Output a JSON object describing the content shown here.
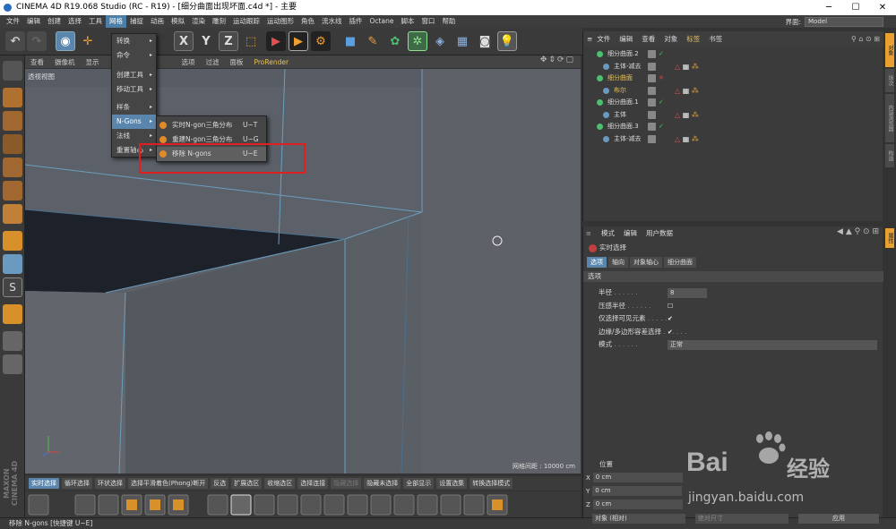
{
  "window": {
    "title": "CINEMA 4D R19.068 Studio (RC - R19) - [细分曲面出现坏面.c4d *] - 主要"
  },
  "menubar": {
    "items": [
      "文件",
      "编辑",
      "创建",
      "选择",
      "工具",
      "网格",
      "捕捉",
      "动画",
      "模拟",
      "渲染",
      "雕刻",
      "运动跟踪",
      "运动图形",
      "角色",
      "流水线",
      "插件",
      "Octane",
      "脚本",
      "窗口",
      "帮助"
    ],
    "active_index": 5,
    "interface_label": "界面:",
    "interface_value": "Model"
  },
  "dropdown": {
    "items": [
      {
        "label": "转换",
        "arrow": "▸"
      },
      {
        "label": "命令",
        "arrow": "▸"
      },
      {
        "label": "创建工具",
        "arrow": "▸"
      },
      {
        "label": "移动工具",
        "arrow": "▸"
      },
      {
        "label": "样条",
        "arrow": "▸"
      },
      {
        "label": "N-Gons",
        "arrow": "▸"
      },
      {
        "label": "法线",
        "arrow": "▸"
      },
      {
        "label": "重置轴心",
        "arrow": "▸"
      }
    ],
    "highlight_index": 5
  },
  "submenu": {
    "items": [
      {
        "label": "实时N-gon三角分布",
        "shortcut": "U~T"
      },
      {
        "label": "重建N-gon三角分布",
        "shortcut": "U~G"
      },
      {
        "label": "移除 N-gons",
        "shortcut": "U~E"
      }
    ],
    "highlight_index": 2
  },
  "viewport": {
    "menu": [
      "查看",
      "摄像机",
      "显示",
      "选项",
      "过滤",
      "面板",
      "ProRender"
    ],
    "label": "透视视图",
    "grid_info": "网格间距 : 10000 cm"
  },
  "bottom_bar": {
    "buttons": [
      "实时选择",
      "循环选择",
      "环状选择",
      "选择平滑着色(Phong)断开",
      "反选",
      "扩展选区",
      "收缩选区",
      "选择连接",
      "隐藏选择",
      "隐藏未选择",
      "全部显示",
      "设置选集",
      "转换选择模式"
    ],
    "active_index": 0,
    "disabled_index": 8
  },
  "status": {
    "text": "移除 N-gons [快捷键 U~E]"
  },
  "object_manager": {
    "menu": [
      "文件",
      "编辑",
      "查看",
      "对象",
      "标签",
      "书签"
    ],
    "active_index": 4,
    "objects": [
      {
        "name": "细分曲面.2",
        "indent": 0,
        "highlight": false,
        "status": "✓"
      },
      {
        "name": "主体-减去",
        "indent": 1,
        "highlight": false,
        "status": ""
      },
      {
        "name": "细分曲面",
        "indent": 0,
        "highlight": true,
        "status": "✕"
      },
      {
        "name": "布尔",
        "indent": 1,
        "highlight": true,
        "status": ""
      },
      {
        "name": "细分曲面.1",
        "indent": 0,
        "highlight": false,
        "status": "✓"
      },
      {
        "name": "主体",
        "indent": 1,
        "highlight": false,
        "status": ""
      },
      {
        "name": "细分曲面.3",
        "indent": 0,
        "highlight": false,
        "status": "✓"
      },
      {
        "name": "主体-减去",
        "indent": 1,
        "highlight": false,
        "status": ""
      }
    ],
    "side_tabs": [
      "对象",
      "场次",
      "内容浏览器",
      "构造"
    ]
  },
  "attributes": {
    "menu": [
      "模式",
      "编辑",
      "用户数据"
    ],
    "title": "实时选择",
    "tabs": [
      "选项",
      "轴向",
      "对象轴心",
      "细分曲面"
    ],
    "active_tab": 0,
    "section": "选项",
    "props": [
      {
        "label": "半径",
        "value": "8"
      },
      {
        "label": "压感半径",
        "value": "☐"
      },
      {
        "label": "仅选择可见元素",
        "value": "✔"
      },
      {
        "label": "边缘/多边形容差选择",
        "value": "✔"
      },
      {
        "label": "模式",
        "value": "正常"
      }
    ],
    "side_tab": "属性"
  },
  "coordinates": {
    "title": "位置",
    "rows": [
      {
        "axis": "X",
        "value": "0 cm"
      },
      {
        "axis": "Y",
        "value": "0 cm"
      },
      {
        "axis": "Z",
        "value": "0 cm"
      }
    ],
    "mode": "对象 (相对)",
    "size_mode": "绝对尺寸",
    "apply": "应用"
  },
  "watermark": {
    "brand": "Bai",
    "cn": "经验",
    "url": "jingyan.baidu.com"
  },
  "colors": {
    "accent": "#5a86ad",
    "highlight_text": "#e8c35a",
    "red_box": "#e02020"
  }
}
